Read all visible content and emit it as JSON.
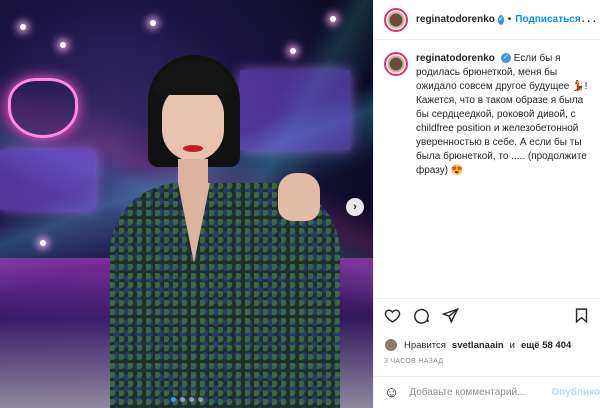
{
  "post": {
    "username": "reginatodorenko",
    "follow_label": "Подписаться",
    "separator": "•",
    "more_icon": "more-horizontal-icon",
    "caption_text": "Если бы я родилась брюнеткой, меня бы ожидало совсем другое будущее 💃! Кажется, что в таком образе я была бы сердцеедкой, роковой дивой, с childfree position и железобетонной уверенностью в себе. А если бы ты была брюнеткой, то ..... (продолжите фразу) 😍"
  },
  "actions": {
    "like_icon": "heart-icon",
    "comment_icon": "comment-icon",
    "share_icon": "share-icon",
    "save_icon": "bookmark-icon"
  },
  "likes": {
    "prefix": "Нравится",
    "user": "svetlanaain",
    "middle": "и",
    "rest": "ещё 58 404"
  },
  "timestamp": "3 ЧАСОВ НАЗАД",
  "comment": {
    "placeholder": "Добавьте комментарий...",
    "publish_label": "Опубликовать",
    "emoji_icon": "smiley-icon"
  },
  "carousel": {
    "next_icon": "chevron-right-icon",
    "active_index": 1,
    "count": 4
  },
  "colors": {
    "link_blue": "#0095f6",
    "verified_blue": "#3897f0",
    "muted": "#8e8e8e"
  }
}
